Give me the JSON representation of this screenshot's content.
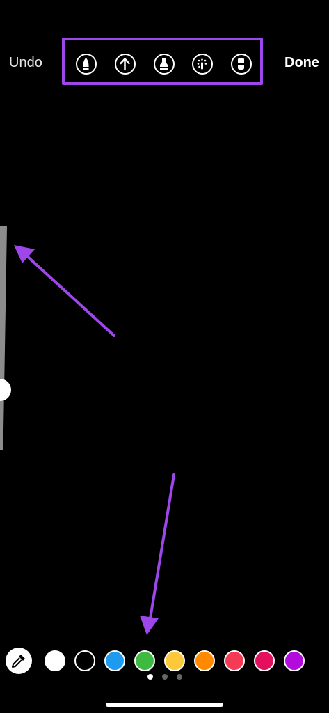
{
  "header": {
    "undo_label": "Undo",
    "done_label": "Done"
  },
  "tools": [
    {
      "icon": "pen-icon"
    },
    {
      "icon": "arrow-icon"
    },
    {
      "icon": "marker-icon"
    },
    {
      "icon": "neon-pen-icon"
    },
    {
      "icon": "eraser-icon"
    }
  ],
  "colors": {
    "highlight": "#9d47ea",
    "palette": [
      "#ffffff",
      "#000000",
      "#1e9bf0",
      "#3dbb41",
      "#ffc73a",
      "#ff8a00",
      "#f53a55",
      "#e4105e",
      "#b30bdd"
    ]
  },
  "page_indicator": {
    "total": 3,
    "active": 1
  }
}
